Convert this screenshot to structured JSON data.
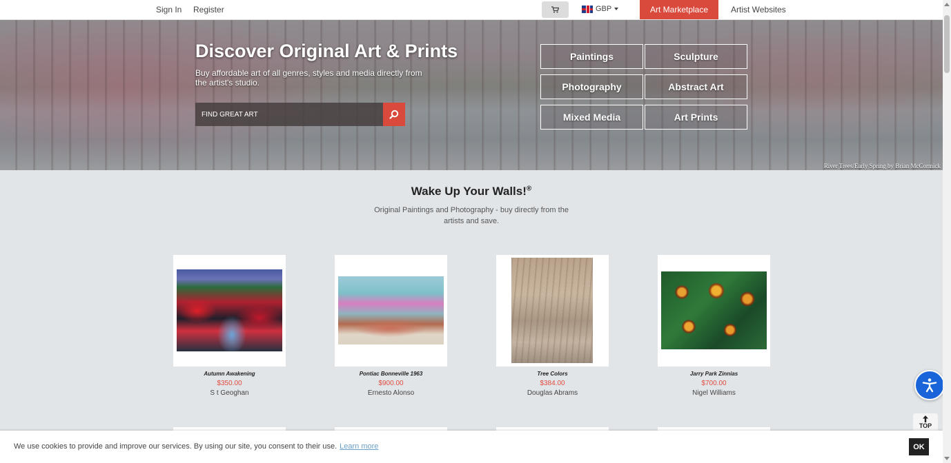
{
  "topbar": {
    "sign_in": "Sign In",
    "register": "Register",
    "currency": "GBP",
    "art_marketplace": "Art Marketplace",
    "artist_websites": "Artist Websites"
  },
  "hero": {
    "title": "Discover Original Art & Prints",
    "subtitle": "Buy affordable art of all genres, styles and media directly from the artist's studio.",
    "search_placeholder": "FIND GREAT ART",
    "categories": [
      "Paintings",
      "Sculpture",
      "Photography",
      "Abstract Art",
      "Mixed Media",
      "Art Prints"
    ],
    "credit": "River Trees/Early Spring by Brian McCormick"
  },
  "main": {
    "title": "Wake Up Your Walls!",
    "title_mark": "®",
    "subtitle": "Original Paintings and Photography - buy directly from the artists and save."
  },
  "artworks": [
    {
      "title": "Autumn Awakening",
      "price": "$350.00",
      "artist": "S t Geoghan"
    },
    {
      "title": "Pontiac Bonneville 1963",
      "price": "$900.00",
      "artist": "Ernesto Alonso"
    },
    {
      "title": "Tree Colors",
      "price": "$384.00",
      "artist": "Douglas Abrams"
    },
    {
      "title": "Jarry Park Zinnias",
      "price": "$700.00",
      "artist": "Nigel Williams"
    }
  ],
  "top_button": "TOP",
  "cookie": {
    "text": "We use cookies to provide and improve our services. By using our site, you consent to their use.",
    "link": "Learn more",
    "ok": "OK"
  },
  "colors": {
    "accent": "#d9493c",
    "price": "#e04b3f",
    "accessibility": "#1864d8"
  }
}
